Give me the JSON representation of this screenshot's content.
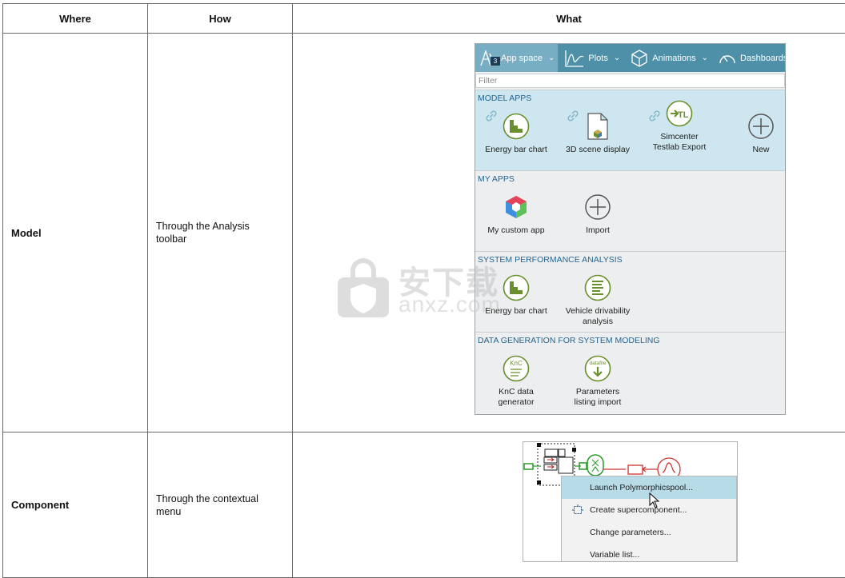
{
  "table": {
    "headers": {
      "where": "Where",
      "how": "How",
      "what": "What"
    },
    "rows": [
      {
        "where": "Model",
        "how": "Through the Analysis toolbar"
      },
      {
        "where": "Component",
        "how": "Through the contextual menu"
      }
    ]
  },
  "panel": {
    "toolbar": [
      {
        "label": "App space",
        "badge": "3",
        "icon": "app-space-icon"
      },
      {
        "label": "Plots",
        "icon": "plots-icon"
      },
      {
        "label": "Animations",
        "icon": "animations-icon"
      },
      {
        "label": "Dashboards",
        "icon": "dashboards-icon"
      }
    ],
    "filter_placeholder": "Filter",
    "sections": [
      {
        "title": "MODEL APPS",
        "tiles": [
          "Energy bar chart",
          "3D scene display",
          "Simcenter Testlab Export",
          "New"
        ]
      },
      {
        "title": "MY APPS",
        "tiles": [
          "My custom app",
          "Import"
        ]
      },
      {
        "title": "SYSTEM PERFORMANCE ANALYSIS",
        "tiles": [
          "Energy bar chart",
          "Vehicle drivability analysis"
        ]
      },
      {
        "title": "DATA GENERATION FOR SYSTEM MODELING",
        "tiles": [
          "KnC data generator",
          "Parameters listing import"
        ]
      }
    ],
    "icon_text": {
      "tl": "TL",
      "knc": "KnC",
      "datafile": "datafile"
    }
  },
  "context_menu": {
    "items": [
      "Launch Polymorphicspool...",
      "Create supercomponent...",
      "Change parameters...",
      "Variable list..."
    ]
  },
  "watermark": {
    "text": "安下载",
    "sub": "anxz.com"
  },
  "colors": {
    "toolbar": "#4d90a8",
    "toolbar_active": "#78aec3",
    "model_apps_bg": "#cde6ef",
    "section_title": "#27658f",
    "app_green": "#6a8f2e",
    "highlight": "#b7dbe7"
  }
}
